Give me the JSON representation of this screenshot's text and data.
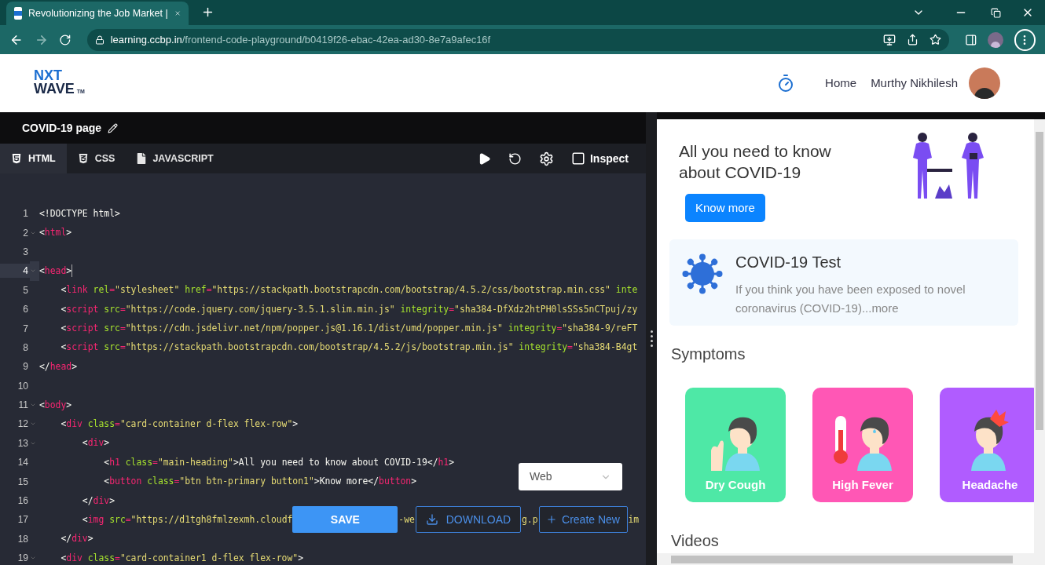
{
  "browser": {
    "tab": {
      "title": "Revolutionizing the Job Market |"
    },
    "url": {
      "host": "learning.ccbp.in",
      "path": "/frontend-code-playground/b0419f26-ebac-42ea-ad30-8e7a9afec16f"
    }
  },
  "header": {
    "logo": {
      "line1": "NXT",
      "line2": "WAVE",
      "mark": "TM"
    },
    "nav": [
      "Home"
    ],
    "user": "Murthy Nikhilesh"
  },
  "editor": {
    "title": "COVID-19 page",
    "tabs": [
      {
        "label": "HTML",
        "kind": "html",
        "selected": true
      },
      {
        "label": "CSS",
        "kind": "css",
        "selected": false
      },
      {
        "label": "JAVASCRIPT",
        "kind": "js",
        "selected": false
      }
    ],
    "inspect": {
      "label": "Inspect",
      "checked": false
    },
    "lines": [
      {
        "number": "1",
        "foldable": false,
        "active": false,
        "tokens": [
          {
            "kind": "text",
            "text": "<!DOCTYPE html>"
          }
        ]
      },
      {
        "number": "2",
        "foldable": true,
        "active": false,
        "tokens": [
          {
            "kind": "p",
            "text": "<"
          },
          {
            "kind": "tag",
            "text": "html"
          },
          {
            "kind": "p",
            "text": ">"
          }
        ]
      },
      {
        "number": "3",
        "foldable": false,
        "active": false
      },
      {
        "number": "4",
        "foldable": true,
        "active": true,
        "tokens": [
          {
            "kind": "p",
            "text": "<"
          },
          {
            "kind": "tag",
            "text": "head"
          },
          {
            "kind": "p",
            "text": ">"
          }
        ]
      },
      {
        "number": "5",
        "foldable": false,
        "active": false,
        "tokens": [
          {
            "kind": "p",
            "text": "    <"
          },
          {
            "kind": "tag",
            "text": "link"
          },
          {
            "kind": "attr",
            "text": " rel"
          },
          {
            "kind": "op",
            "text": "="
          },
          {
            "kind": "str",
            "text": "\"stylesheet\""
          },
          {
            "kind": "attr",
            "text": " href"
          },
          {
            "kind": "op",
            "text": "="
          },
          {
            "kind": "str",
            "text": "\"https://stackpath.bootstrapcdn.com/bootstrap/4.5.2/css/bootstrap.min.css\""
          },
          {
            "kind": "attr",
            "text": " inte"
          }
        ]
      },
      {
        "number": "6",
        "foldable": false,
        "active": false,
        "tokens": [
          {
            "kind": "p",
            "text": "    <"
          },
          {
            "kind": "tag",
            "text": "script"
          },
          {
            "kind": "attr",
            "text": " src"
          },
          {
            "kind": "op",
            "text": "="
          },
          {
            "kind": "str",
            "text": "\"https://code.jquery.com/jquery-3.5.1.slim.min.js\""
          },
          {
            "kind": "attr",
            "text": " integrity"
          },
          {
            "kind": "op",
            "text": "="
          },
          {
            "kind": "str",
            "text": "\"sha384-DfXdz2htPH0lsSSs5nCTpuj/zy"
          }
        ]
      },
      {
        "number": "7",
        "foldable": false,
        "active": false,
        "tokens": [
          {
            "kind": "p",
            "text": "    <"
          },
          {
            "kind": "tag",
            "text": "script"
          },
          {
            "kind": "attr",
            "text": " src"
          },
          {
            "kind": "op",
            "text": "="
          },
          {
            "kind": "str",
            "text": "\"https://cdn.jsdelivr.net/npm/popper.js@1.16.1/dist/umd/popper.min.js\""
          },
          {
            "kind": "attr",
            "text": " integrity"
          },
          {
            "kind": "op",
            "text": "="
          },
          {
            "kind": "str",
            "text": "\"sha384-9/reFT"
          }
        ]
      },
      {
        "number": "8",
        "foldable": false,
        "active": false,
        "tokens": [
          {
            "kind": "p",
            "text": "    <"
          },
          {
            "kind": "tag",
            "text": "script"
          },
          {
            "kind": "attr",
            "text": " src"
          },
          {
            "kind": "op",
            "text": "="
          },
          {
            "kind": "str",
            "text": "\"https://stackpath.bootstrapcdn.com/bootstrap/4.5.2/js/bootstrap.min.js\""
          },
          {
            "kind": "attr",
            "text": " integrity"
          },
          {
            "kind": "op",
            "text": "="
          },
          {
            "kind": "str",
            "text": "\"sha384-B4gt"
          }
        ]
      },
      {
        "number": "9",
        "foldable": false,
        "active": false,
        "tokens": [
          {
            "kind": "p",
            "text": "</"
          },
          {
            "kind": "tag",
            "text": "head"
          },
          {
            "kind": "p",
            "text": ">"
          }
        ]
      },
      {
        "number": "10",
        "foldable": false,
        "active": false
      },
      {
        "number": "11",
        "foldable": true,
        "active": false,
        "tokens": [
          {
            "kind": "p",
            "text": "<"
          },
          {
            "kind": "tag",
            "text": "body"
          },
          {
            "kind": "p",
            "text": ">"
          }
        ]
      },
      {
        "number": "12",
        "foldable": true,
        "active": false,
        "tokens": [
          {
            "kind": "p",
            "text": "    <"
          },
          {
            "kind": "tag",
            "text": "div"
          },
          {
            "kind": "attr",
            "text": " class"
          },
          {
            "kind": "op",
            "text": "="
          },
          {
            "kind": "str",
            "text": "\"card-container d-flex flex-row\""
          },
          {
            "kind": "p",
            "text": ">"
          }
        ]
      },
      {
        "number": "13",
        "foldable": true,
        "active": false,
        "tokens": [
          {
            "kind": "p",
            "text": "        <"
          },
          {
            "kind": "tag",
            "text": "div"
          },
          {
            "kind": "p",
            "text": ">"
          }
        ]
      },
      {
        "number": "14",
        "foldable": false,
        "active": false,
        "tokens": [
          {
            "kind": "p",
            "text": "            <"
          },
          {
            "kind": "tag",
            "text": "h1"
          },
          {
            "kind": "attr",
            "text": " class"
          },
          {
            "kind": "op",
            "text": "="
          },
          {
            "kind": "str",
            "text": "\"main-heading\""
          },
          {
            "kind": "p",
            "text": ">All you need to know about COVID-19</"
          },
          {
            "kind": "tag",
            "text": "h1"
          },
          {
            "kind": "p",
            "text": ">"
          }
        ]
      },
      {
        "number": "15",
        "foldable": false,
        "active": false,
        "tokens": [
          {
            "kind": "p",
            "text": "            <"
          },
          {
            "kind": "tag",
            "text": "button"
          },
          {
            "kind": "attr",
            "text": " class"
          },
          {
            "kind": "op",
            "text": "="
          },
          {
            "kind": "str",
            "text": "\"btn btn-primary button1\""
          },
          {
            "kind": "p",
            "text": ">Know more</"
          },
          {
            "kind": "tag",
            "text": "button"
          },
          {
            "kind": "p",
            "text": ">"
          }
        ]
      },
      {
        "number": "16",
        "foldable": false,
        "active": false,
        "tokens": [
          {
            "kind": "p",
            "text": "        </"
          },
          {
            "kind": "tag",
            "text": "div"
          },
          {
            "kind": "p",
            "text": ">"
          }
        ]
      },
      {
        "number": "17",
        "foldable": false,
        "active": false,
        "tokens": [
          {
            "kind": "p",
            "text": "        <"
          },
          {
            "kind": "tag",
            "text": "img"
          },
          {
            "kind": "attr",
            "text": " src"
          },
          {
            "kind": "op",
            "text": "="
          },
          {
            "kind": "str",
            "text": "\"https://d1tgh8fmlzexmh.cloudf"
          }
        ],
        "covered_tail": [
          "-we",
          "g.p",
          "im"
        ]
      },
      {
        "number": "18",
        "foldable": false,
        "active": false,
        "tokens": [
          {
            "kind": "p",
            "text": "    </"
          },
          {
            "kind": "tag",
            "text": "div"
          },
          {
            "kind": "p",
            "text": ">"
          }
        ]
      },
      {
        "number": "19",
        "foldable": true,
        "active": false,
        "tokens": [
          {
            "kind": "p",
            "text": "    <"
          },
          {
            "kind": "tag",
            "text": "div"
          },
          {
            "kind": "attr",
            "text": " class"
          },
          {
            "kind": "op",
            "text": "="
          },
          {
            "kind": "str",
            "text": "\"card-container1 d-flex flex-row\""
          },
          {
            "kind": "p",
            "text": ">"
          }
        ]
      }
    ],
    "target": {
      "value": "Web"
    },
    "actions": [
      {
        "label": "SAVE",
        "kind": "save"
      },
      {
        "label": "DOWNLOAD",
        "kind": "download"
      },
      {
        "label": "Create New",
        "kind": "create"
      }
    ]
  },
  "preview": {
    "hero": {
      "heading": "All you need to know about COVID-19",
      "button": "Know more"
    },
    "test_card": {
      "title": "COVID-19 Test",
      "text": "If you think you have been exposed to novel coronavirus (COVID-19)...more"
    },
    "symptoms": {
      "heading": "Symptoms",
      "cards": [
        {
          "label": "Dry Cough",
          "kind": "cough",
          "color": "#4ee8a6"
        },
        {
          "label": "High Fever",
          "kind": "fever",
          "color": "#ff57b5"
        },
        {
          "label": "Headache",
          "kind": "headache",
          "color": "#b05cff"
        }
      ]
    },
    "videos_heading": "Videos"
  }
}
